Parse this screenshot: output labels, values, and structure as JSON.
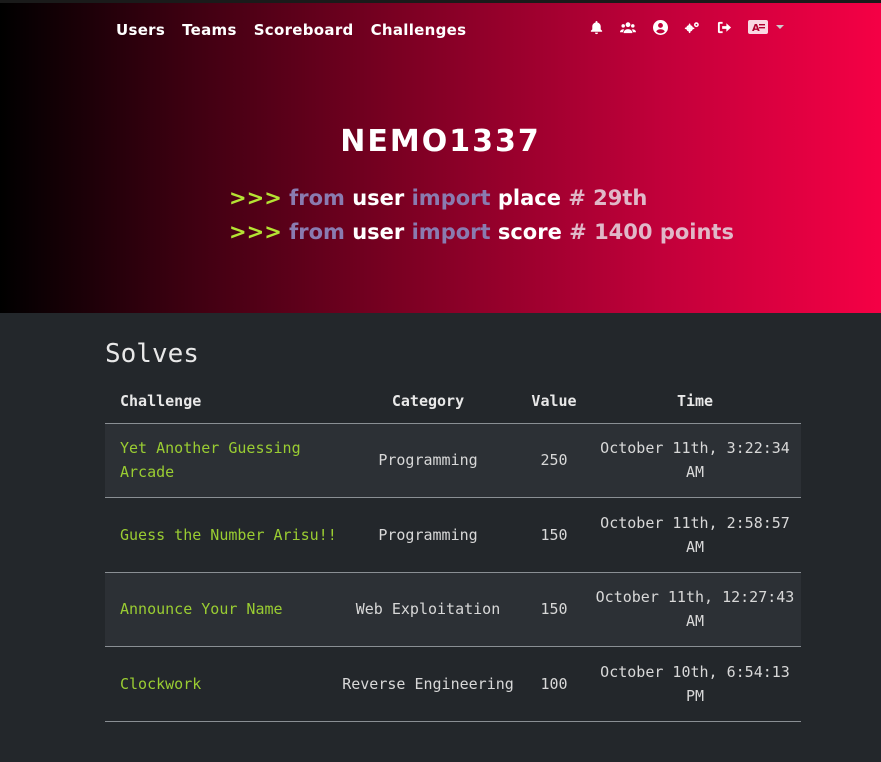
{
  "nav": {
    "links": [
      "Users",
      "Teams",
      "Scoreboard",
      "Challenges"
    ],
    "icons": [
      "bell-icon",
      "team-icon",
      "user-circle-icon",
      "settings-icon",
      "logout-icon",
      "language-icon"
    ]
  },
  "profile": {
    "username": "NEMO1337",
    "line1": {
      "prompt": ">>>",
      "from": "from",
      "module": "user",
      "import": "import",
      "field": "place",
      "value": "# 29th"
    },
    "line2": {
      "prompt": ">>>",
      "from": "from",
      "module": "user",
      "import": "import",
      "field": "score",
      "value": "# 1400 points"
    }
  },
  "solves": {
    "title": "Solves",
    "headers": {
      "challenge": "Challenge",
      "category": "Category",
      "value": "Value",
      "time": "Time"
    },
    "rows": [
      {
        "challenge": "Yet Another Guessing Arcade",
        "category": "Programming",
        "value": "250",
        "time": "October 11th, 3:22:34 AM"
      },
      {
        "challenge": "Guess the Number Arisu!!",
        "category": "Programming",
        "value": "150",
        "time": "October 11th, 2:58:57 AM"
      },
      {
        "challenge": "Announce Your Name",
        "category": "Web Exploitation",
        "value": "150",
        "time": "October 11th, 12:27:43 AM"
      },
      {
        "challenge": "Clockwork",
        "category": "Reverse Engineering",
        "value": "100",
        "time": "October 10th, 6:54:13 PM"
      }
    ]
  },
  "colors": {
    "accent_green": "#9acd32",
    "gradient_start": "#000000",
    "gradient_end": "#f50045",
    "background": "#23272b"
  }
}
